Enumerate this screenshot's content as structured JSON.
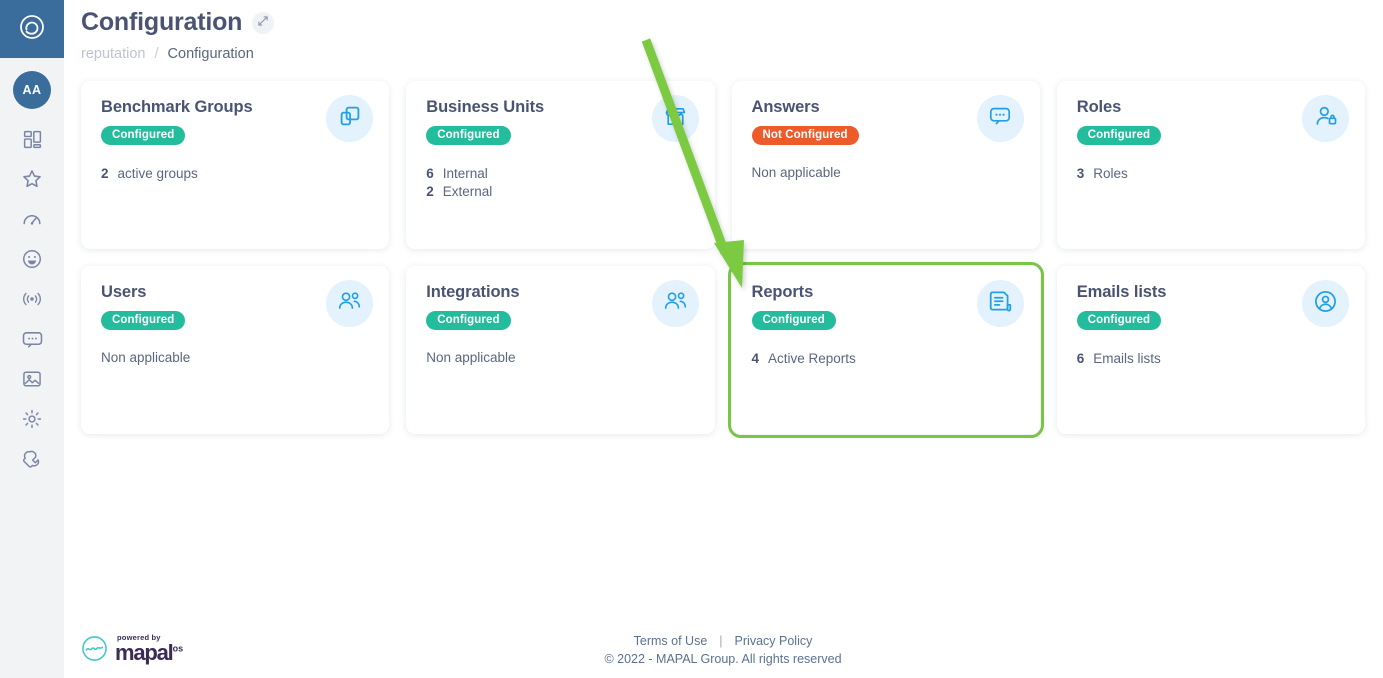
{
  "sidebar": {
    "brand_icon": "swirl-logo-icon",
    "avatar_initials": "AA",
    "items": [
      {
        "icon": "dashboard-grid-icon",
        "name": "dashboard"
      },
      {
        "icon": "star-icon",
        "name": "favourites"
      },
      {
        "icon": "speedometer-icon",
        "name": "performance"
      },
      {
        "icon": "smiley-icon",
        "name": "satisfaction"
      },
      {
        "icon": "broadcast-icon",
        "name": "broadcast"
      },
      {
        "icon": "chat-bubble-icon",
        "name": "messages"
      },
      {
        "icon": "image-icon",
        "name": "media"
      },
      {
        "icon": "gear-icon",
        "name": "settings"
      },
      {
        "icon": "wrench-icon",
        "name": "tools"
      }
    ]
  },
  "header": {
    "title": "Configuration",
    "expand_icon": "expand-arrows-icon",
    "breadcrumb": {
      "parent": "reputation",
      "separator": "/",
      "current": "Configuration"
    }
  },
  "cards": [
    {
      "title": "Benchmark Groups",
      "badge": "Configured",
      "badge_state": "ok",
      "icon": "copy-squares-icon",
      "stats": [
        {
          "num": "2",
          "label": "active groups"
        }
      ],
      "plain": "",
      "highlighted": false
    },
    {
      "title": "Business Units",
      "badge": "Configured",
      "badge_state": "ok",
      "icon": "storefront-icon",
      "stats": [
        {
          "num": "6",
          "label": "Internal"
        },
        {
          "num": "2",
          "label": "External"
        }
      ],
      "plain": "",
      "highlighted": false
    },
    {
      "title": "Answers",
      "badge": "Not Configured",
      "badge_state": "no",
      "icon": "chat-bubble-dots-icon",
      "stats": [],
      "plain": "Non applicable",
      "highlighted": false
    },
    {
      "title": "Roles",
      "badge": "Configured",
      "badge_state": "ok",
      "icon": "user-lock-icon",
      "stats": [
        {
          "num": "3",
          "label": "Roles"
        }
      ],
      "plain": "",
      "highlighted": false
    },
    {
      "title": "Users",
      "badge": "Configured",
      "badge_state": "ok",
      "icon": "two-users-icon",
      "stats": [],
      "plain": "Non applicable",
      "highlighted": false
    },
    {
      "title": "Integrations",
      "badge": "Configured",
      "badge_state": "ok",
      "icon": "two-users-icon",
      "stats": [],
      "plain": "Non applicable",
      "highlighted": false
    },
    {
      "title": "Reports",
      "badge": "Configured",
      "badge_state": "ok",
      "icon": "document-report-icon",
      "stats": [
        {
          "num": "4",
          "label": "Active Reports"
        }
      ],
      "plain": "",
      "highlighted": true
    },
    {
      "title": "Emails lists",
      "badge": "Configured",
      "badge_state": "ok",
      "icon": "user-circle-icon",
      "stats": [
        {
          "num": "6",
          "label": "Emails lists"
        }
      ],
      "plain": "",
      "highlighted": false
    }
  ],
  "footer": {
    "logo_powered": "powered by",
    "logo_word": "mapal",
    "logo_suffix": "os",
    "terms_label": "Terms of Use",
    "separator": "|",
    "privacy_label": "Privacy Policy",
    "copyright": "© 2022 - MAPAL Group. All rights reserved"
  },
  "annotation": {
    "arrow_color": "#79C644",
    "highlight_color": "#79C644",
    "target": "Reports"
  },
  "colors": {
    "brand_blue": "#3A6C9C",
    "badge_ok": "#23BC9C",
    "badge_no": "#EE5B2B",
    "card_icon_bg": "#E3F2FC",
    "card_icon_stroke": "#21A0E8",
    "text_dark": "#4A5472",
    "text_muted": "#5A6680",
    "sidebar_bg": "#F2F3F5"
  }
}
